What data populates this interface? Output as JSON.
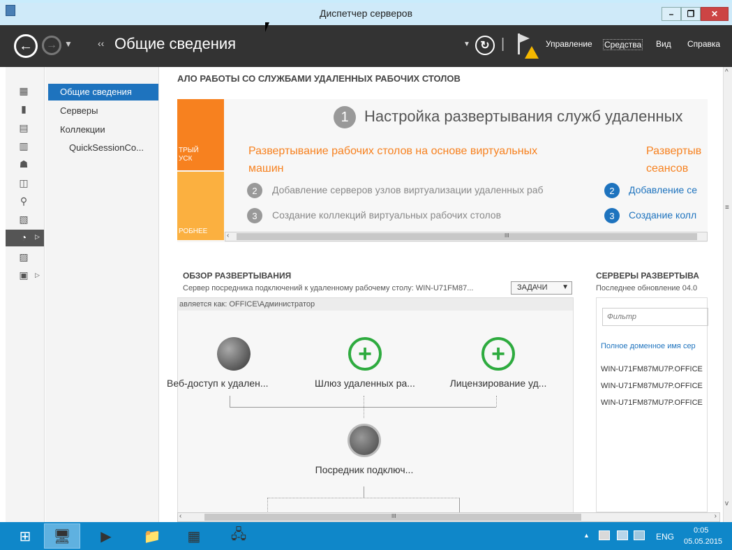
{
  "window": {
    "title": "Диспетчер серверов",
    "min": "–",
    "restore": "❐",
    "close": "✕"
  },
  "header": {
    "back": "←",
    "forward": "→",
    "breadcrumb_prefix": "‹‹",
    "title": "Общие сведения",
    "refresh": "↻",
    "sep": "|",
    "menus": [
      "Управление",
      "Средства",
      "Вид",
      "Справка"
    ]
  },
  "nav": {
    "items": [
      "Общие сведения",
      "Серверы",
      "Коллекции",
      "QuickSessionCo..."
    ]
  },
  "left_icons": [
    "▦",
    "▮",
    "▤",
    "▥",
    "☗",
    "◫",
    "⚲",
    "▧",
    "◔",
    "▨",
    "▣"
  ],
  "quickstart": {
    "heading": "АЛО РАБОТЫ СО СЛУЖБАМИ УДАЛЕННЫХ РАБОЧИХ СТОЛОВ",
    "tile_top": "ТРЫЙ\nУСК",
    "tile_bottom": "РОБНЕЕ",
    "step1_num": "1",
    "step1": "Настройка развертывания служб удаленных",
    "col1_title": "Развертывание рабочих столов на основе виртуальных машин",
    "col2_title": "Развертыв сеансов",
    "col1_steps": [
      {
        "n": "2",
        "t": "Добавление серверов узлов виртуализации удаленных раб"
      },
      {
        "n": "3",
        "t": "Создание коллекций виртуальных рабочих столов"
      }
    ],
    "col2_steps": [
      {
        "n": "2",
        "t": "Добавление се"
      },
      {
        "n": "3",
        "t": "Создание колл"
      }
    ],
    "scroll_grip": "III"
  },
  "overview": {
    "title": "ОБЗОР РАЗВЕРТЫВАНИЯ",
    "subtitle": "Сервер посредника подключений к удаленному рабочему столу: WIN-U71FM87...",
    "tasks": "ЗАДАЧИ",
    "managed_as": "авляется как: OFFICE\\Администратор",
    "roles": [
      "Веб-доступ к удален...",
      "Шлюз удаленных ра...",
      "Лицензирование уд..."
    ],
    "broker": "Посредник подключ...",
    "scroll_grip": "III"
  },
  "servers": {
    "title": "СЕРВЕРЫ РАЗВЕРТЫВА",
    "updated": "Последнее обновление 04.0",
    "filter_placeholder": "Фильтр",
    "col_header": "Полное доменное имя сер",
    "rows": [
      "WIN-U71FM87MU7P.OFFICE",
      "WIN-U71FM87MU7P.OFFICE",
      "WIN-U71FM87MU7P.OFFICE"
    ]
  },
  "taskbar": {
    "lang": "ENG",
    "time": "0:05",
    "date": "05.05.2015",
    "tray_arrow": "▲"
  },
  "colors": {
    "accent": "#1e73be",
    "orange": "#f7811f",
    "light_orange": "#fbb040",
    "green": "#2eab3f",
    "taskbar": "#0f87c9"
  }
}
